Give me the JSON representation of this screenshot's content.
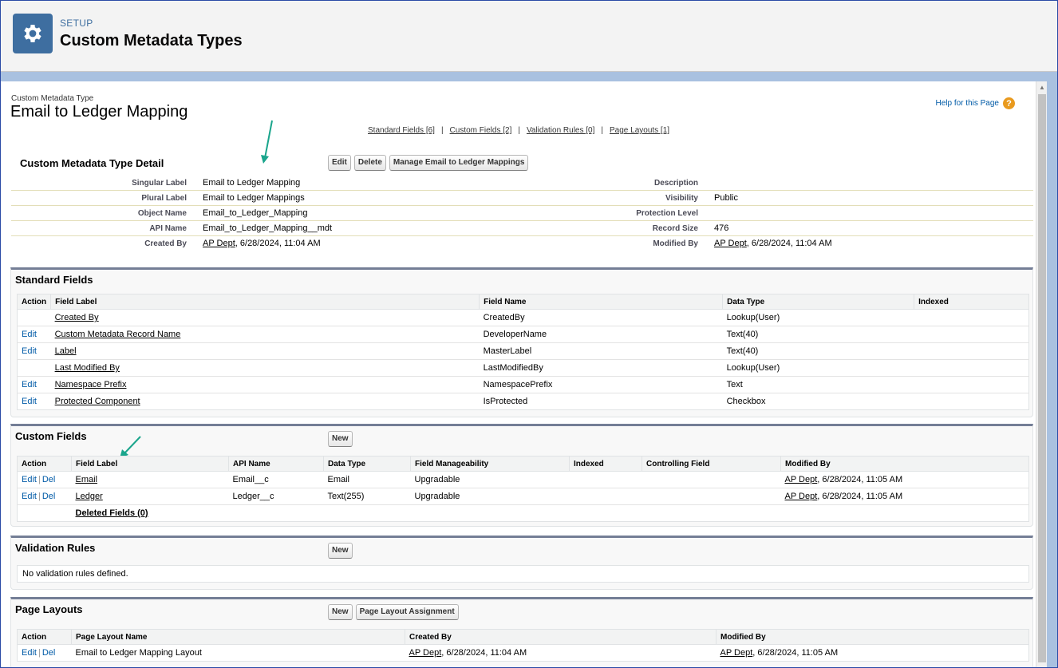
{
  "header": {
    "setup_label": "SETUP",
    "title": "Custom Metadata Types",
    "icon": "gear-icon"
  },
  "page": {
    "type_label": "Custom Metadata Type",
    "title": "Email to Ledger Mapping",
    "help_label": "Help for this Page"
  },
  "related_links": [
    "Standard Fields [6]",
    "Custom Fields [2]",
    "Validation Rules [0]",
    "Page Layouts [1]"
  ],
  "detail": {
    "heading": "Custom Metadata Type Detail",
    "buttons": [
      "Edit",
      "Delete",
      "Manage Email to Ledger Mappings"
    ],
    "rows": [
      {
        "left_label": "Singular Label",
        "left_value": "Email to Ledger Mapping",
        "right_label": "Description",
        "right_value": ""
      },
      {
        "left_label": "Plural Label",
        "left_value": "Email to Ledger Mappings",
        "right_label": "Visibility",
        "right_value": "Public"
      },
      {
        "left_label": "Object Name",
        "left_value": "Email_to_Ledger_Mapping",
        "right_label": "Protection Level",
        "right_value": ""
      },
      {
        "left_label": "API Name",
        "left_value": "Email_to_Ledger_Mapping__mdt",
        "right_label": "Record Size",
        "right_value": "476"
      }
    ],
    "created_by_label": "Created By",
    "created_by_user": "AP Dept",
    "created_by_date": ", 6/28/2024, 11:04 AM",
    "modified_by_label": "Modified By",
    "modified_by_user": "AP Dept",
    "modified_by_date": ", 6/28/2024, 11:04 AM"
  },
  "standard_fields": {
    "title": "Standard Fields",
    "columns": [
      "Action",
      "Field Label",
      "Field Name",
      "Data Type",
      "Indexed"
    ],
    "rows": [
      {
        "action": "",
        "label": "Created By",
        "name": "CreatedBy",
        "type": "Lookup(User)",
        "indexed": ""
      },
      {
        "action": "Edit",
        "label": "Custom Metadata Record Name",
        "name": "DeveloperName",
        "type": "Text(40)",
        "indexed": ""
      },
      {
        "action": "Edit",
        "label": "Label",
        "name": "MasterLabel",
        "type": "Text(40)",
        "indexed": ""
      },
      {
        "action": "",
        "label": "Last Modified By",
        "name": "LastModifiedBy",
        "type": "Lookup(User)",
        "indexed": ""
      },
      {
        "action": "Edit",
        "label": "Namespace Prefix",
        "name": "NamespacePrefix",
        "type": "Text",
        "indexed": ""
      },
      {
        "action": "Edit",
        "label": "Protected Component",
        "name": "IsProtected",
        "type": "Checkbox",
        "indexed": ""
      }
    ]
  },
  "custom_fields": {
    "title": "Custom Fields",
    "new_label": "New",
    "columns": [
      "Action",
      "Field Label",
      "API Name",
      "Data Type",
      "Field Manageability",
      "Indexed",
      "Controlling Field",
      "Modified By"
    ],
    "edit_label": "Edit",
    "del_label": "Del",
    "rows": [
      {
        "label": "Email",
        "api": "Email__c",
        "type": "Email",
        "manageability": "Upgradable",
        "indexed": "",
        "controlling": "",
        "modified_user": "AP Dept",
        "modified_date": ", 6/28/2024, 11:05 AM"
      },
      {
        "label": "Ledger",
        "api": "Ledger__c",
        "type": "Text(255)",
        "manageability": "Upgradable",
        "indexed": "",
        "controlling": "",
        "modified_user": "AP Dept",
        "modified_date": ", 6/28/2024, 11:05 AM"
      }
    ],
    "deleted_fields": "Deleted Fields (0)"
  },
  "validation_rules": {
    "title": "Validation Rules",
    "new_label": "New",
    "empty_text": "No validation rules defined."
  },
  "page_layouts": {
    "title": "Page Layouts",
    "new_label": "New",
    "assignment_label": "Page Layout Assignment",
    "columns": [
      "Action",
      "Page Layout Name",
      "Created By",
      "Modified By"
    ],
    "edit_label": "Edit",
    "del_label": "Del",
    "rows": [
      {
        "name": "Email to Ledger Mapping Layout",
        "created_user": "AP Dept",
        "created_date": ", 6/28/2024, 11:04 AM",
        "modified_user": "AP Dept",
        "modified_date": ", 6/28/2024, 11:05 AM"
      }
    ]
  },
  "colors": {
    "accent": "#3e6ea0",
    "link": "#015ba7",
    "arrow": "#1aa58c",
    "section_border": "#747e96"
  }
}
